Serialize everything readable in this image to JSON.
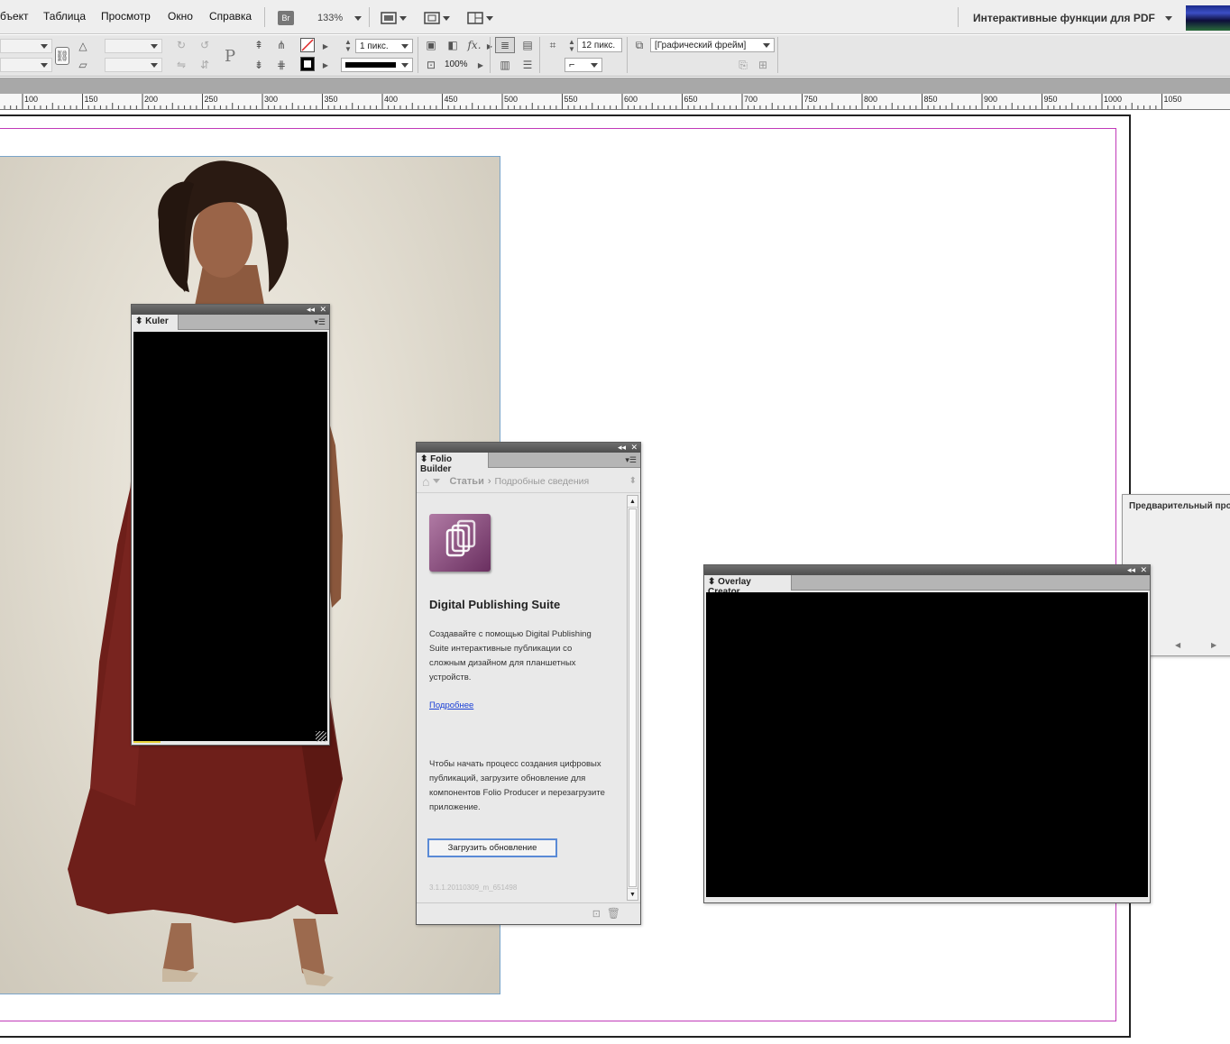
{
  "menubar": {
    "items": [
      "бъект",
      "Таблица",
      "Просмотр",
      "Окно",
      "Справка"
    ],
    "bridge_label": "Br",
    "zoom": "133%",
    "workspace": "Интерактивные функции для PDF"
  },
  "control": {
    "stroke_weight": "1 пикс.",
    "opacity": "100%",
    "size_field": "12 пикс.",
    "object_style": "[Графический фрейм]"
  },
  "ruler": {
    "labels": [
      "100",
      "150",
      "200",
      "250",
      "300",
      "350",
      "400",
      "450",
      "500",
      "550",
      "600",
      "650",
      "700",
      "750",
      "800",
      "850",
      "900",
      "950",
      "1000",
      "1050"
    ]
  },
  "kuler": {
    "tab": "Kuler"
  },
  "folio": {
    "tab": "Folio Builder",
    "breadcrumb_current": "Статьи",
    "breadcrumb_next": "Подробные сведения",
    "title": "Digital Publishing Suite",
    "description": "Создавайте с помощью Digital Publishing Suite интерактивные публикации со сложным дизайном для планшетных устройств.",
    "link": "Подробнее",
    "instructions": "Чтобы начать процесс создания цифровых публикаций, загрузите обновление для компонентов Folio Producer и перезагрузите приложение.",
    "button": "Загрузить обновление",
    "version": "3.1.1.20110309_m_651498"
  },
  "overlay": {
    "tab": "Overlay Creator"
  },
  "preview": {
    "title": "Предварительный про"
  },
  "colors": {
    "margin_guide": "#c13ab9",
    "frame_edge": "#7aa4c8",
    "button_border": "#5a8ad6"
  }
}
